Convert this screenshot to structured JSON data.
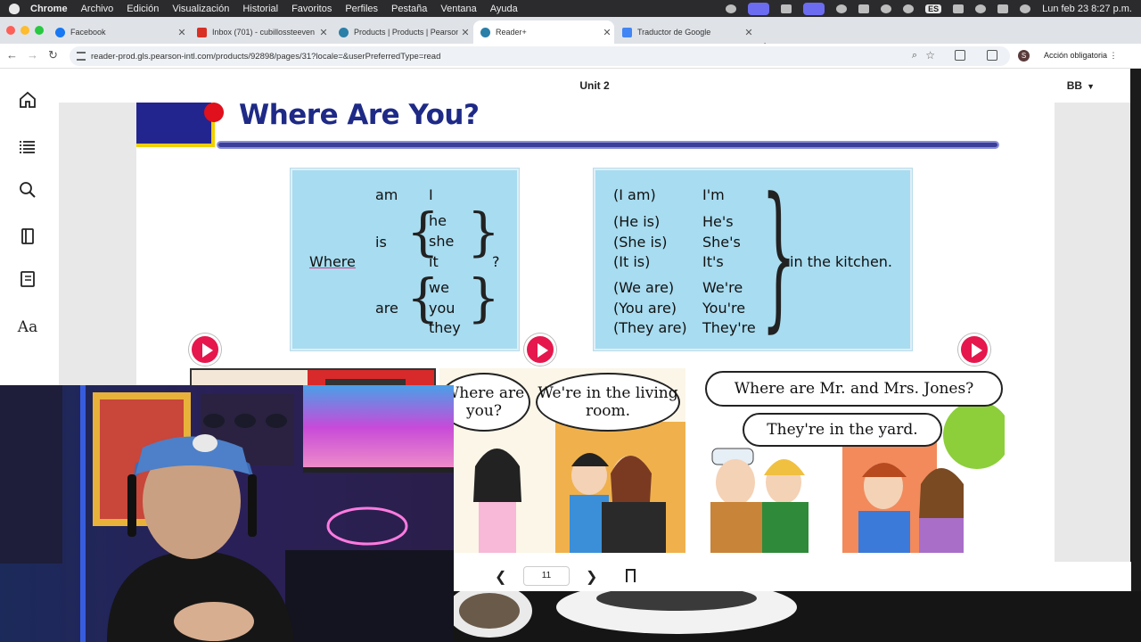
{
  "menubar": {
    "app": "Chrome",
    "items": [
      "Archivo",
      "Edición",
      "Visualización",
      "Historial",
      "Favoritos",
      "Perfiles",
      "Pestaña",
      "Ventana",
      "Ayuda"
    ],
    "lang": "ES",
    "datetime": "Lun feb 23  8:27 p.m."
  },
  "tabs": [
    {
      "title": "Facebook",
      "color": "#1877f2"
    },
    {
      "title": "Inbox (701) - cubillossteeven",
      "color": "#d93025"
    },
    {
      "title": "Products | Products | Pearson",
      "color": "#2a7fa8"
    },
    {
      "title": "Reader+",
      "color": "#2a7fa8"
    },
    {
      "title": "Traductor de Google",
      "color": "#4285f4"
    }
  ],
  "toolbar": {
    "url": "reader-prod.gls.pearson-intl.com/products/92898/pages/31?locale=&userPreferredType=read",
    "profile_initial": "S",
    "action_label": "Acción obligatoria"
  },
  "reader": {
    "unit_title": "Unit 2",
    "user": "BB",
    "page_title": "Where Are You?",
    "page_number": "11"
  },
  "grammar_left": {
    "where": "Where",
    "am": "am",
    "am_pron": "I",
    "is": "is",
    "is_prons": [
      "he",
      "she",
      "it"
    ],
    "are": "are",
    "are_prons": [
      "we",
      "you",
      "they"
    ],
    "qmark": "?"
  },
  "grammar_right": {
    "full": [
      "(I am)",
      "(He is)",
      "(She is)",
      "(It is)",
      "(We are)",
      "(You are)",
      "(They are)"
    ],
    "short": [
      "I'm",
      "He's",
      "She's",
      "It's",
      "We're",
      "You're",
      "They're"
    ],
    "tail": "in the kitchen."
  },
  "comics": {
    "q1": "Where are you?",
    "a1": "We're in the living room.",
    "q2": "Where are Mr. and Mrs. Jones?",
    "a2": "They're in the yard."
  },
  "colors": {
    "title_blue": "#1e2a86",
    "grammar_bg": "#a8dcf0",
    "play_red": "#e5174d"
  }
}
